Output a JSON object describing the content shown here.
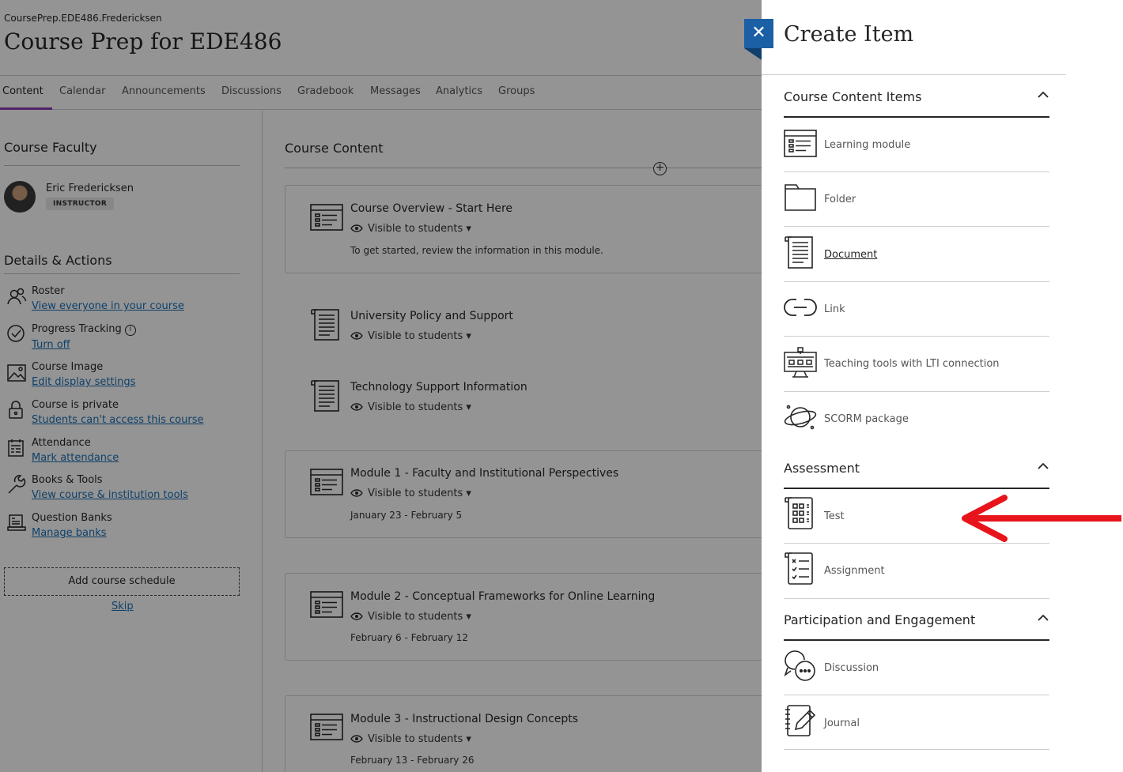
{
  "header": {
    "course_id": "CoursePrep.EDE486.Fredericksen",
    "course_title": "Course Prep for EDE486"
  },
  "nav": {
    "tabs": [
      {
        "label": "Content",
        "active": true
      },
      {
        "label": "Calendar"
      },
      {
        "label": "Announcements"
      },
      {
        "label": "Discussions"
      },
      {
        "label": "Gradebook"
      },
      {
        "label": "Messages"
      },
      {
        "label": "Analytics"
      },
      {
        "label": "Groups"
      }
    ],
    "accent_color": "#8b3db6"
  },
  "sidebar": {
    "faculty_heading": "Course Faculty",
    "faculty_name": "Eric Fredericksen",
    "faculty_role": "INSTRUCTOR",
    "details_heading": "Details & Actions",
    "actions": [
      {
        "icon": "roster-icon",
        "title": "Roster",
        "link": "View everyone in your course"
      },
      {
        "icon": "progress-check-icon",
        "title": "Progress Tracking",
        "link": "Turn off",
        "info_icon": "info-icon"
      },
      {
        "icon": "image-icon",
        "title": "Course Image",
        "link": "Edit display settings"
      },
      {
        "icon": "lock-icon",
        "title": "Course is private",
        "link": "Students can't access this course"
      },
      {
        "icon": "attendance-icon",
        "title": "Attendance",
        "link": "Mark attendance"
      },
      {
        "icon": "wrench-icon",
        "title": "Books & Tools",
        "link": "View course & institution tools"
      },
      {
        "icon": "question-bank-icon",
        "title": "Question Banks",
        "link": "Manage banks"
      }
    ],
    "schedule_button": "Add course schedule",
    "skip_link": "Skip"
  },
  "content": {
    "heading": "Course Content",
    "visibility_label": "Visible to students",
    "items": [
      {
        "icon": "learning-module-icon",
        "title": "Course Overview - Start Here",
        "description": "To get started, review the information in this module."
      },
      {
        "icon": "document-icon",
        "title": "University Policy and Support"
      },
      {
        "icon": "document-icon",
        "title": "Technology Support Information"
      },
      {
        "icon": "learning-module-icon",
        "title": "Module 1 - Faculty and Institutional Perspectives",
        "description": "January 23 - February 5"
      },
      {
        "icon": "learning-module-icon",
        "title": "Module 2 - Conceptual Frameworks for Online Learning",
        "description": "February 6 - February 12"
      },
      {
        "icon": "learning-module-icon",
        "title": "Module 3 - Instructional Design Concepts",
        "description": "February 13 - February 26"
      }
    ]
  },
  "panel": {
    "title": "Create Item",
    "close_icon": "close-icon",
    "close_color": "#1b5fa4",
    "groups": [
      {
        "heading": "Course Content Items",
        "items": [
          {
            "icon": "learning-module-icon",
            "label": "Learning module"
          },
          {
            "icon": "folder-icon",
            "label": "Folder"
          },
          {
            "icon": "document-icon",
            "label": "Document"
          },
          {
            "icon": "link-icon",
            "label": "Link"
          },
          {
            "icon": "lti-tool-icon",
            "label": "Teaching tools with LTI connection"
          },
          {
            "icon": "scorm-icon",
            "label": "SCORM package"
          }
        ]
      },
      {
        "heading": "Assessment",
        "items": [
          {
            "icon": "test-icon",
            "label": "Test"
          },
          {
            "icon": "assignment-icon",
            "label": "Assignment"
          }
        ]
      },
      {
        "heading": "Participation and Engagement",
        "items": [
          {
            "icon": "discussion-icon",
            "label": "Discussion"
          },
          {
            "icon": "journal-icon",
            "label": "Journal"
          }
        ]
      }
    ]
  },
  "annotation": {
    "icon": "red-arrow-icon",
    "color": "#e8141b"
  }
}
